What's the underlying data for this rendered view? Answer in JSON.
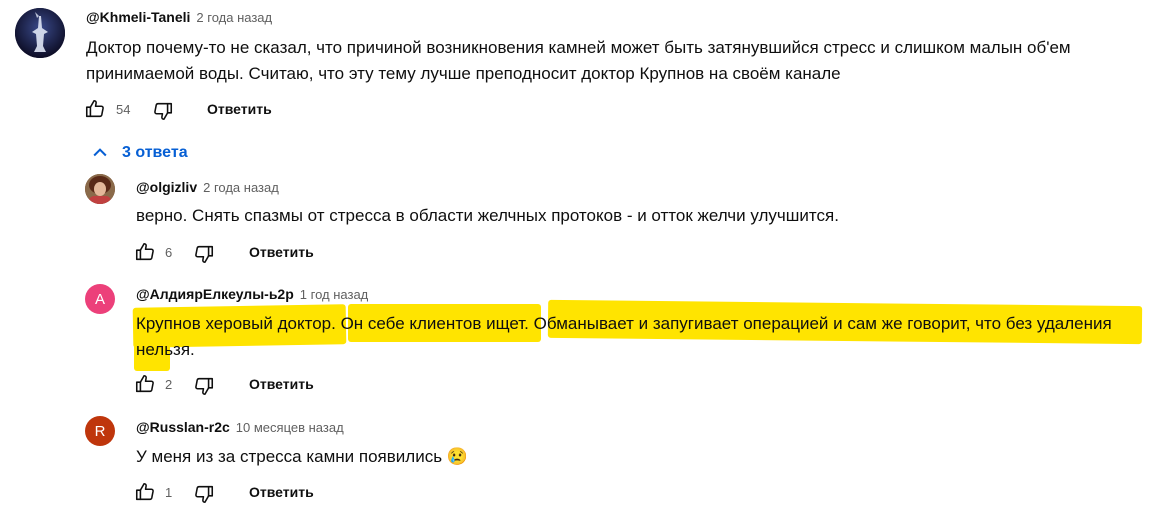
{
  "comments": [
    {
      "handle": "@Khmeli-Taneli",
      "time": "2 года назад",
      "text": "Доктор почему-то не сказал, что причиной возникновения камней может быть затянувшийся стресс и слишком малын об'ем принимаемой воды. Считаю, что эту тему лучше преподносит доктор Крупнов на своём канале",
      "likes": "54",
      "reply_label": "Ответить",
      "avatar_icon": "statue-avatar-icon"
    }
  ],
  "replies_toggle": {
    "label": "3 ответа"
  },
  "replies": [
    {
      "handle": "@olgizliv",
      "time": "2 года назад",
      "text": "верно. Снять спазмы от стресса  в области желчных протоков - и отток желчи улучшится.",
      "likes": "6",
      "reply_label": "Ответить",
      "avatar_icon": "photo-avatar-icon"
    },
    {
      "handle": "@АлдиярЕлкеулы-ь2р",
      "time": "1 год назад",
      "text": "Крупнов херовый доктор. Он себе клиентов ищет. Обманывает и запугивает операцией и сам же говорит, что без удаления нельзя.",
      "likes": "2",
      "reply_label": "Ответить",
      "avatar_letter": "A",
      "avatar_color": "#ec407a"
    },
    {
      "handle": "@Russlan-r2c",
      "time": "10 месяцев назад",
      "text": "У меня из за стресса камни появились 😢",
      "likes": "1",
      "reply_label": "Ответить",
      "avatar_letter": "R",
      "avatar_color": "#bf360c"
    }
  ],
  "colors": {
    "link": "#065fd4",
    "highlight": "#ffe400",
    "secondary_text": "#606060"
  }
}
